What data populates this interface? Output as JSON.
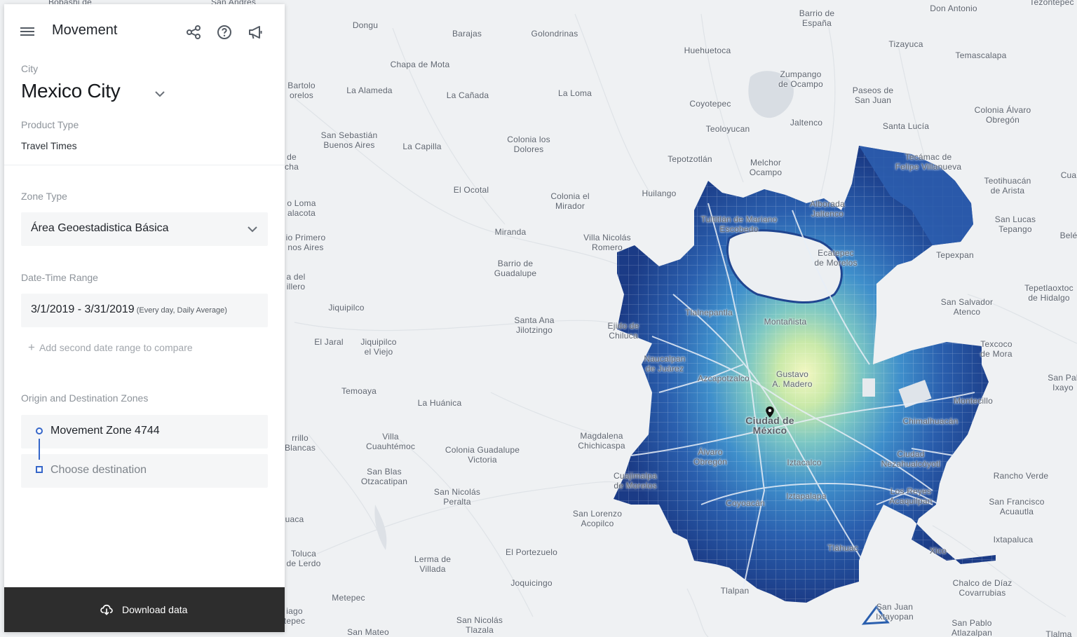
{
  "app": {
    "title": "Movement",
    "icons": [
      "menu-icon",
      "share-icon",
      "help-icon",
      "announcement-icon"
    ]
  },
  "city": {
    "label": "City",
    "value": "Mexico City"
  },
  "product_type": {
    "label": "Product Type",
    "value": "Travel Times"
  },
  "zone_type": {
    "label": "Zone Type",
    "value": "Área Geoestadistica Básica"
  },
  "date_range": {
    "label": "Date-Time Range",
    "value": "3/1/2019 - 3/31/2019",
    "detail": "(Every day, Daily Average)",
    "add_compare": "Add second date range to compare"
  },
  "od": {
    "label": "Origin and Destination Zones",
    "origin": "Movement Zone 4744",
    "destination_placeholder": "Choose destination"
  },
  "download": {
    "label": "Download data"
  },
  "colors": {
    "heat_low": "#1c3f8a",
    "heat_mid": "#3d86c6",
    "heat_high": "#e6f0a8",
    "accent": "#3566c9",
    "download_bg": "#2d2d2d"
  },
  "map": {
    "places": [
      {
        "name": "Bobashi de",
        "cls": ""
      },
      {
        "name": "San Andres",
        "cls": ""
      },
      {
        "name": "Dongu",
        "cls": ""
      },
      {
        "name": "Barajas",
        "cls": ""
      },
      {
        "name": "Golondrinas",
        "cls": ""
      },
      {
        "name": "Barrio de\nEspaña",
        "cls": ""
      },
      {
        "name": "Don Antonio",
        "cls": ""
      },
      {
        "name": "Tezontepec",
        "cls": ""
      },
      {
        "name": "Huehuetoca",
        "cls": ""
      },
      {
        "name": "Tizayuca",
        "cls": ""
      },
      {
        "name": "Temascalapa",
        "cls": ""
      },
      {
        "name": "Chapa de Mota",
        "cls": ""
      },
      {
        "name": "Zumpango\nde Ocampo",
        "cls": ""
      },
      {
        "name": "Bartolo\norelos",
        "cls": ""
      },
      {
        "name": "La Alameda",
        "cls": ""
      },
      {
        "name": "La Cañada",
        "cls": ""
      },
      {
        "name": "La Loma",
        "cls": ""
      },
      {
        "name": "Paseos de\nSan Juan",
        "cls": ""
      },
      {
        "name": "Coyotepec",
        "cls": ""
      },
      {
        "name": "Colonia Álvaro\nObregón",
        "cls": ""
      },
      {
        "name": "Jaltenco",
        "cls": ""
      },
      {
        "name": "Santa Lucía",
        "cls": ""
      },
      {
        "name": "Teoloyucan",
        "cls": ""
      },
      {
        "name": "San Sebastián\nBuenos Aires",
        "cls": ""
      },
      {
        "name": "La Capilla",
        "cls": ""
      },
      {
        "name": "Colonia los\nDolores",
        "cls": ""
      },
      {
        "name": "Tepotzotlán",
        "cls": ""
      },
      {
        "name": "Melchor\nOcampo",
        "cls": ""
      },
      {
        "name": "Tecámac de\nFelipe Villanueva",
        "cls": ""
      },
      {
        "name": "de\ncha",
        "cls": ""
      },
      {
        "name": "Teotihuacán\nde Arista",
        "cls": ""
      },
      {
        "name": "Cua",
        "cls": ""
      },
      {
        "name": "El Ocotal",
        "cls": ""
      },
      {
        "name": "Colonia el\nMirador",
        "cls": ""
      },
      {
        "name": "Huilango",
        "cls": ""
      },
      {
        "name": "o Loma\nalacota",
        "cls": ""
      },
      {
        "name": "Alborada\nJaltenco",
        "cls": ""
      },
      {
        "name": "Tultitlán de Mariano\nEscobedo",
        "cls": ""
      },
      {
        "name": "San Lucas\nTepango",
        "cls": ""
      },
      {
        "name": "Belé",
        "cls": ""
      },
      {
        "name": "Miranda",
        "cls": ""
      },
      {
        "name": "Villa Nicolás\nRomero",
        "cls": ""
      },
      {
        "name": "io Primero\nnos Aires",
        "cls": ""
      },
      {
        "name": "Ecatepec\nde Morelos",
        "cls": ""
      },
      {
        "name": "Tepexpan",
        "cls": ""
      },
      {
        "name": "Barrio de\nGuadalupe",
        "cls": ""
      },
      {
        "name": "a del\nillero",
        "cls": ""
      },
      {
        "name": "Tepetlaoxtoc\nde Hidalgo",
        "cls": ""
      },
      {
        "name": "Jiquipilco",
        "cls": ""
      },
      {
        "name": "Tlalnepantla",
        "cls": ""
      },
      {
        "name": "San Salvador\nAtenco",
        "cls": ""
      },
      {
        "name": "Santa Ana\nJilotzingo",
        "cls": ""
      },
      {
        "name": "Montañista",
        "cls": ""
      },
      {
        "name": "Ejido de\nChiluca",
        "cls": ""
      },
      {
        "name": "El Jaral",
        "cls": ""
      },
      {
        "name": "Jiquipilco\nel Viejo",
        "cls": ""
      },
      {
        "name": "Texcoco\nde Mora",
        "cls": ""
      },
      {
        "name": "Naucalpan\nde Juárez",
        "cls": ""
      },
      {
        "name": "San Pal\nIxayo",
        "cls": ""
      },
      {
        "name": "Azcapotzalco",
        "cls": ""
      },
      {
        "name": "Gustavo\nA. Madero",
        "cls": ""
      },
      {
        "name": "Temoaya",
        "cls": ""
      },
      {
        "name": "La Huánica",
        "cls": ""
      },
      {
        "name": "Montecillo",
        "cls": ""
      },
      {
        "name": "Ciudad de\nMéxico",
        "cls": "big"
      },
      {
        "name": "Chimalhuacán",
        "cls": ""
      },
      {
        "name": "rrillo\nBlancas",
        "cls": ""
      },
      {
        "name": "Villa\nCuauhtémoc",
        "cls": ""
      },
      {
        "name": "Magdalena\nChichicaspa",
        "cls": ""
      },
      {
        "name": "Colonia Guadalupe\nVictoria",
        "cls": ""
      },
      {
        "name": "Álvaro\nObregón",
        "cls": ""
      },
      {
        "name": "Ciudad\nNezahualcóyotl",
        "cls": ""
      },
      {
        "name": "Iztacalco",
        "cls": ""
      },
      {
        "name": "San Blas\nOtzacatipan",
        "cls": ""
      },
      {
        "name": "Cuajimalpa\nde Morelos",
        "cls": ""
      },
      {
        "name": "Rancho Verde",
        "cls": ""
      },
      {
        "name": "San Nicolás\nPeralta",
        "cls": ""
      },
      {
        "name": "Los Reyes\nAcaquilpan",
        "cls": ""
      },
      {
        "name": "Iztapalapa",
        "cls": ""
      },
      {
        "name": "Coyoacán",
        "cls": ""
      },
      {
        "name": "San Francisco\nAcuautla",
        "cls": ""
      },
      {
        "name": "uaca",
        "cls": ""
      },
      {
        "name": "San Lorenzo\nAcopilco",
        "cls": ""
      },
      {
        "name": "Ixtapaluca",
        "cls": ""
      },
      {
        "name": "Tláhuac",
        "cls": ""
      },
      {
        "name": "Xico",
        "cls": ""
      },
      {
        "name": "Toluca\nde Lerdo",
        "cls": ""
      },
      {
        "name": "El Portezuelo",
        "cls": ""
      },
      {
        "name": "Lerma de\nVillada",
        "cls": ""
      },
      {
        "name": "Joquicingo",
        "cls": ""
      },
      {
        "name": "Chalco de Díaz\nCovarrubias",
        "cls": ""
      },
      {
        "name": "Tlalpan",
        "cls": ""
      },
      {
        "name": "Metepec",
        "cls": ""
      },
      {
        "name": "iago\ntepec",
        "cls": ""
      },
      {
        "name": "San Juan\nIxtayopan",
        "cls": ""
      },
      {
        "name": "San Nicolás\nTlazala",
        "cls": ""
      },
      {
        "name": "San Pablo\nAtlazalpan",
        "cls": ""
      },
      {
        "name": "San Mateo",
        "cls": ""
      },
      {
        "name": "Tlalma",
        "cls": ""
      }
    ]
  }
}
